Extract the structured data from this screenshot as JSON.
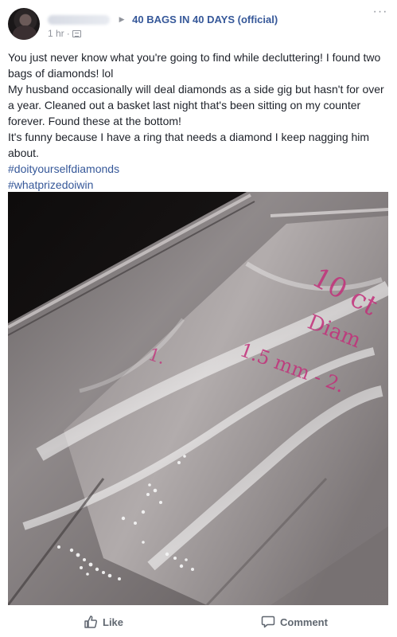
{
  "post": {
    "group_name": "40 BAGS IN 40 DAYS (official)",
    "time": "1 hr",
    "paragraphs": [
      "You just never know what you're going to find while decluttering! I found two bags of diamonds! lol",
      "My husband occasionally will deal diamonds as a side gig but hasn't for over a year. Cleaned out a basket last night that's been sitting on my counter forever. Found these at the bottom!",
      "It's funny because I have a ring that needs a diamond I keep nagging him about."
    ],
    "hashtags": [
      "#doityourselfdiamonds",
      "#whatprizedoiwin"
    ],
    "photo_writing": [
      "10 ct",
      "Diam",
      "1.5 mm - 2.",
      "1."
    ]
  },
  "actions": {
    "like_label": "Like",
    "comment_label": "Comment"
  },
  "icons": {
    "more": "ellipsis-icon",
    "audience": "group-audience-icon",
    "like": "thumbs-up-icon",
    "comment": "speech-bubble-icon"
  },
  "colors": {
    "link": "#365899",
    "meta": "#90949c",
    "text": "#1d2129",
    "ink": "#c2307a"
  }
}
